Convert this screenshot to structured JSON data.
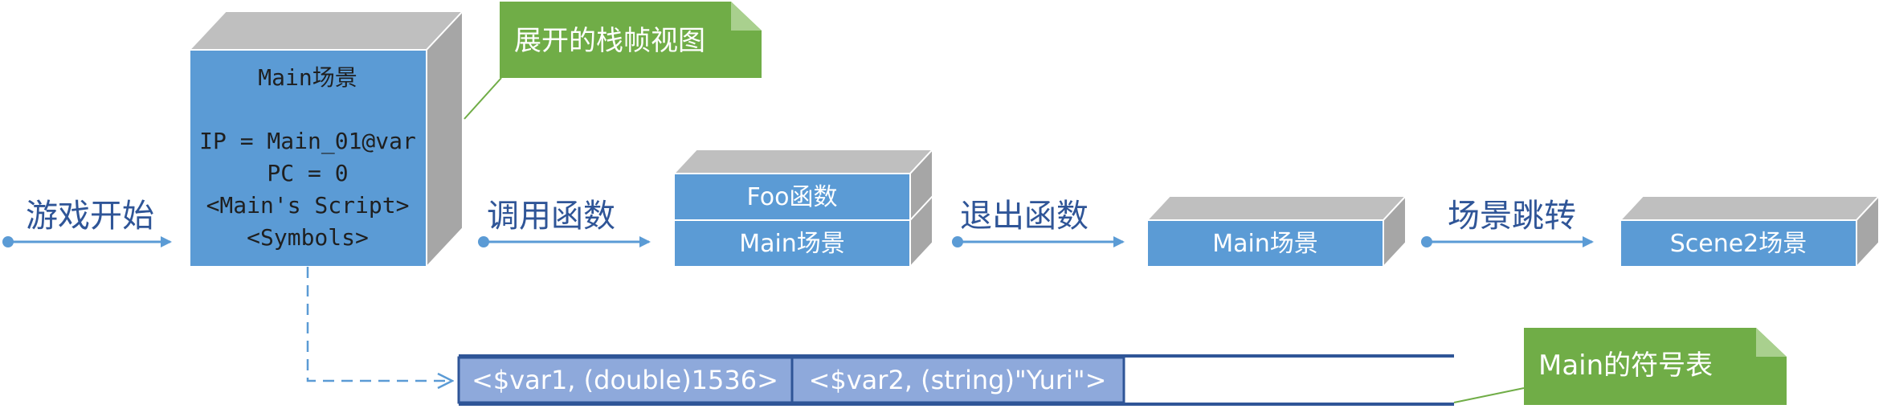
{
  "steps": {
    "start": "游戏开始",
    "call": "调用函数",
    "exit": "退出函数",
    "jump": "场景跳转"
  },
  "main_frame": {
    "title": "Main场景",
    "ip": "IP = Main_01@var",
    "pc": "PC = 0",
    "script": "<Main's Script>",
    "symbols": "<Symbols>"
  },
  "stack_call": {
    "top": "Foo函数",
    "bottom": "Main场景"
  },
  "stack_exit": {
    "frame": "Main场景"
  },
  "stack_jump": {
    "frame": "Scene2场景"
  },
  "callouts": {
    "expanded_frame": "展开的栈帧视图",
    "symbol_table": "Main的符号表"
  },
  "symbol_table": {
    "entries": [
      "<$var1, (double)1536>",
      "<$var2, (string)\"Yuri\">"
    ]
  },
  "colors": {
    "box_blue": "#5B9BD5",
    "box_top": "#BFBFBF",
    "box_side": "#A6A6A6",
    "table_blue": "#8EA9DB",
    "table_border": "#2F5597",
    "callout_green": "#70AD47",
    "arrow": "#4472C4"
  }
}
